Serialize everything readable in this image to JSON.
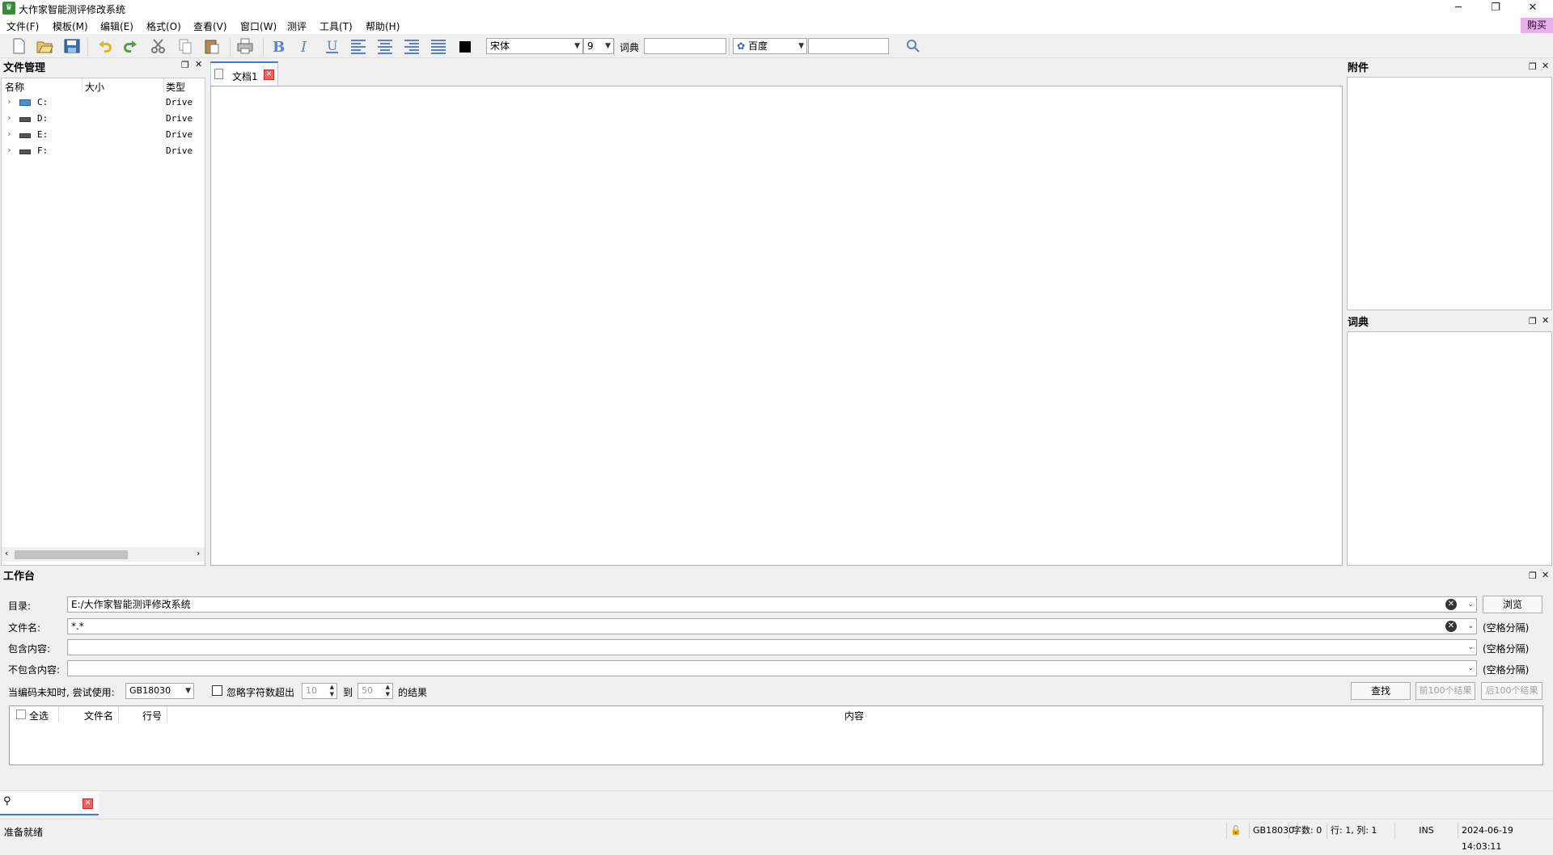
{
  "window": {
    "title": "大作家智能测评修改系统",
    "minimize": "─",
    "restore": "❐",
    "close": "✕"
  },
  "menu": {
    "items": [
      "文件(F)",
      "模板(M)",
      "编辑(E)",
      "格式(O)",
      "查看(V)",
      "窗口(W)",
      "测评",
      "工具(T)",
      "帮助(H)"
    ],
    "buy": "购买"
  },
  "toolbar": {
    "font": "宋体",
    "size": "9",
    "dict_label": "词典",
    "dict_value": "",
    "engine": "百度",
    "search_value": ""
  },
  "file_panel": {
    "title": "文件管理",
    "columns": [
      "名称",
      "大小",
      "类型"
    ],
    "drives": [
      {
        "name": "C:",
        "type": "Drive"
      },
      {
        "name": "D:",
        "type": "Drive"
      },
      {
        "name": "E:",
        "type": "Drive"
      },
      {
        "name": "F:",
        "type": "Drive"
      }
    ]
  },
  "document": {
    "tab_label": "文档1"
  },
  "attach_panel": {
    "title": "附件"
  },
  "dict_panel": {
    "title": "词典"
  },
  "workbench": {
    "title": "工作台",
    "dir_label": "目录:",
    "dir_value": "E:/大作家智能测评修改系统",
    "browse": "浏览",
    "filename_label": "文件名:",
    "filename_value": "*.*",
    "contains_label": "包含内容:",
    "excludes_label": "不包含内容:",
    "space_sep": "(空格分隔)",
    "encoding_label": "当编码未知时, 尝试使用:",
    "encoding_value": "GB18030",
    "ignore_label": "忽略字符数超出",
    "from_value": "10",
    "to_label": "到",
    "to_value": "50",
    "result_suffix": "的结果",
    "find": "查找",
    "prev": "前100个结果",
    "next": "后100个结果",
    "result_columns": {
      "select_all": "全选",
      "filename": "文件名",
      "line": "行号",
      "content": "内容"
    }
  },
  "status": {
    "ready": "准备就绪",
    "encoding": "GB18030",
    "words": "字数: 0",
    "position": "行: 1, 列: 1",
    "mode": "INS",
    "datetime": "2024-06-19 14:03:11"
  }
}
